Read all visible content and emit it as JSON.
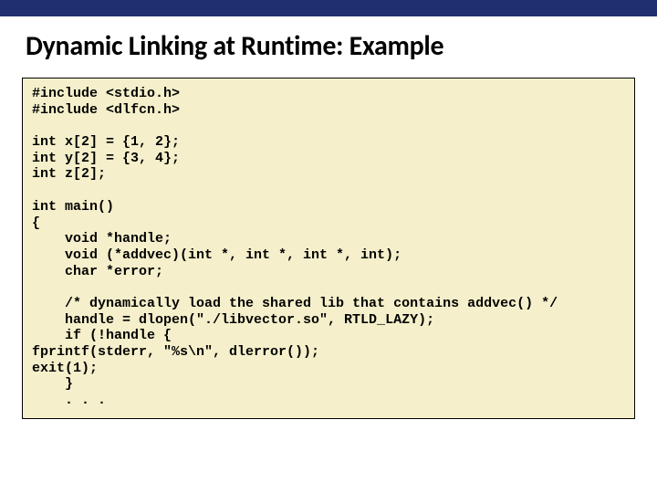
{
  "title": "Dynamic Linking at Runtime: Example",
  "code": "#include <stdio.h>\n#include <dlfcn.h>\n\nint x[2] = {1, 2};\nint y[2] = {3, 4};\nint z[2];\n\nint main()\n{\n    void *handle;\n    void (*addvec)(int *, int *, int *, int);\n    char *error;\n\n    /* dynamically load the shared lib that contains addvec() */\n    handle = dlopen(\"./libvector.so\", RTLD_LAZY);\n    if (!handle {\nfprintf(stderr, \"%s\\n\", dlerror());\nexit(1);\n    }\n    . . ."
}
